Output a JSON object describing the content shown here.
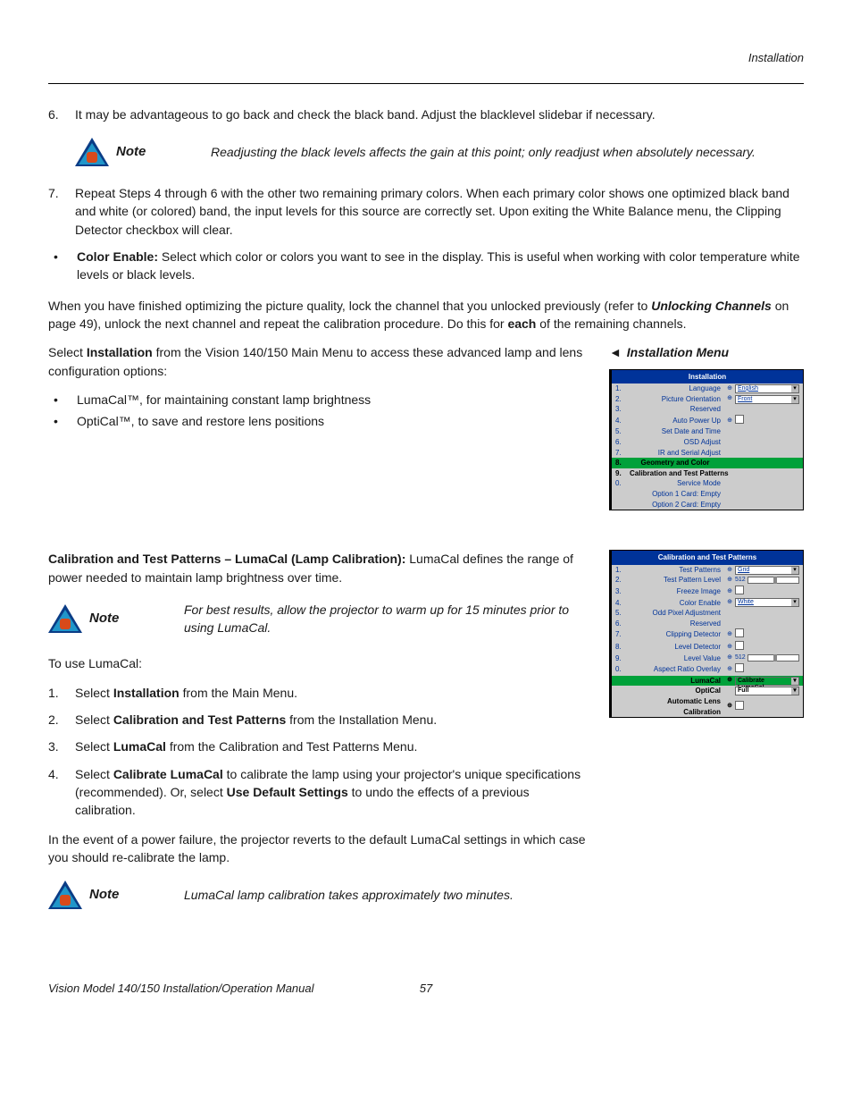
{
  "header": {
    "section": "Installation"
  },
  "step6": {
    "num": "6.",
    "text": "It may be advantageous to go back and check the black band. Adjust the blacklevel slidebar if necessary."
  },
  "note1": {
    "label": "Note",
    "text": "Readjusting the black levels affects the gain at this point; only readjust when absolutely necessary."
  },
  "step7": {
    "num": "7.",
    "text": "Repeat Steps 4 through 6 with the other two remaining primary colors. When each primary color shows one optimized black band and white (or colored) band, the input levels for this source are correctly set. Upon exiting the White Balance menu, the Clipping Detector checkbox will clear."
  },
  "bullet_color_enable": {
    "label": "Color Enable:",
    "text": " Select which color or colors you want to see in the display. This is useful when working with color temperature white levels or black levels."
  },
  "para_lock": {
    "pre": "When you have finished optimizing the picture quality, lock the channel that you unlocked previously (refer to ",
    "link": "Unlocking Channels",
    "mid": " on page 49), unlock the next channel and repeat the calibration procedure. Do this for ",
    "each": "each",
    "post": " of the remaining channels."
  },
  "para_install": {
    "pre": "Select ",
    "bold": "Installation",
    "post": " from the Vision 140/150 Main Menu to access these advanced lamp and lens configuration options:"
  },
  "bullets_options": {
    "a": "LumaCal™, for maintaining constant lamp brightness",
    "b": "OptiCal™, to save and restore lens positions"
  },
  "side_heading": "Installation Menu",
  "para_lumacal": {
    "bold": "Calibration and Test Patterns – LumaCal (Lamp Calibration):",
    "text": " LumaCal defines the range of power needed to maintain lamp brightness over time."
  },
  "note2": {
    "label": "Note",
    "text": "For best results, allow the projector to warm up for 15 minutes prior to using LumaCal."
  },
  "to_use": "To use LumaCal:",
  "steps": {
    "s1": {
      "num": "1.",
      "pre": "Select ",
      "bold": "Installation",
      "post": " from the Main Menu."
    },
    "s2": {
      "num": "2.",
      "pre": "Select ",
      "bold": "Calibration and Test Patterns",
      "post": " from the Installation Menu."
    },
    "s3": {
      "num": "3.",
      "pre": "Select ",
      "bold": "LumaCal",
      "post": " from the Calibration and Test Patterns Menu."
    },
    "s4": {
      "num": "4.",
      "pre": "Select ",
      "bold1": "Calibrate LumaCal",
      "mid": " to calibrate the lamp using your projector's unique specifications (recommended). Or, select ",
      "bold2": "Use Default Settings",
      "post": " to undo the effects of a previous calibration."
    }
  },
  "para_power": "In the event of a power failure, the projector reverts to the default LumaCal settings in which case you should re-calibrate the lamp.",
  "note3": {
    "label": "Note",
    "text": "LumaCal lamp calibration takes approximately two minutes."
  },
  "menu1": {
    "title": "Installation",
    "rows": {
      "r1": {
        "n": "1.",
        "label": "Language",
        "val": "English"
      },
      "r2": {
        "n": "2.",
        "label": "Picture Orientation",
        "val": "Front"
      },
      "r3": {
        "n": "3.",
        "label": "Reserved"
      },
      "r4": {
        "n": "4.",
        "label": "Auto Power Up"
      },
      "r5": {
        "n": "5.",
        "label": "Set Date and Time"
      },
      "r6": {
        "n": "6.",
        "label": "OSD Adjust"
      },
      "r7": {
        "n": "7.",
        "label": "IR and Serial Adjust"
      },
      "r8": {
        "n": "8.",
        "label": "Geometry and Color"
      },
      "r9": {
        "n": "9.",
        "label": "Calibration and Test Patterns"
      },
      "r0": {
        "n": "0.",
        "label": "Service Mode"
      },
      "ro1": {
        "label": "Option 1 Card: Empty"
      },
      "ro2": {
        "label": "Option 2 Card: Empty"
      }
    }
  },
  "menu2": {
    "title": "Calibration and Test Patterns",
    "rows": {
      "r1": {
        "n": "1.",
        "label": "Test Patterns",
        "val": "Grid"
      },
      "r2": {
        "n": "2.",
        "label": "Test Pattern Level",
        "val": "512"
      },
      "r3": {
        "n": "3.",
        "label": "Freeze Image"
      },
      "r4": {
        "n": "4.",
        "label": "Color Enable",
        "val": "White"
      },
      "r5": {
        "n": "5.",
        "label": "Odd Pixel Adjustment"
      },
      "r6": {
        "n": "6.",
        "label": "Reserved"
      },
      "r7": {
        "n": "7.",
        "label": "Clipping Detector"
      },
      "r8": {
        "n": "8.",
        "label": "Level Detector"
      },
      "r9": {
        "n": "9.",
        "label": "Level Value",
        "val": "512"
      },
      "r0": {
        "n": "0.",
        "label": "Aspect Ratio Overlay"
      },
      "rl": {
        "label": "LumaCal",
        "val": "Calibrate LumaCal"
      },
      "ro": {
        "label": "OptiCal",
        "val": "Full"
      },
      "ra": {
        "label": "Automatic Lens Calibration"
      }
    }
  },
  "footer": {
    "title": "Vision Model 140/150 Installation/Operation Manual",
    "page": "57"
  }
}
